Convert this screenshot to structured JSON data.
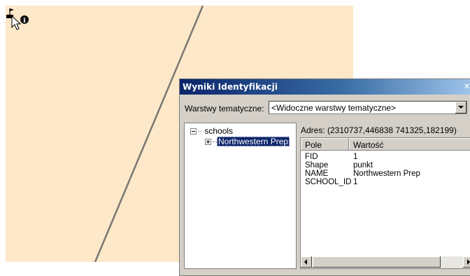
{
  "dialog": {
    "title": "Wyniki Identyfikacji",
    "layers_label": "Warstwy tematyczne:",
    "layers_value": "<Widoczne warstwy tematyczne>"
  },
  "tree": {
    "root": "schools",
    "child": "Northwestern Prep"
  },
  "results": {
    "address": "Adres: (2310737,446838 741325,182199)",
    "columns": [
      "Pole",
      "Wartość"
    ],
    "rows": [
      {
        "field": "FID",
        "value": "1"
      },
      {
        "field": "Shape",
        "value": "punkt"
      },
      {
        "field": "NAME",
        "value": "Northwestern Prep"
      },
      {
        "field": "SCHOOL_ID",
        "value": "1"
      }
    ]
  },
  "icons": {
    "identify_cursor": "identify-cursor-icon",
    "info": "info-icon",
    "flag": "flag-icon"
  },
  "colors": {
    "map_background": "#fde8c9",
    "titlebar_start": "#0a246a",
    "titlebar_end": "#a6caf0",
    "selection": "#0a246a"
  }
}
